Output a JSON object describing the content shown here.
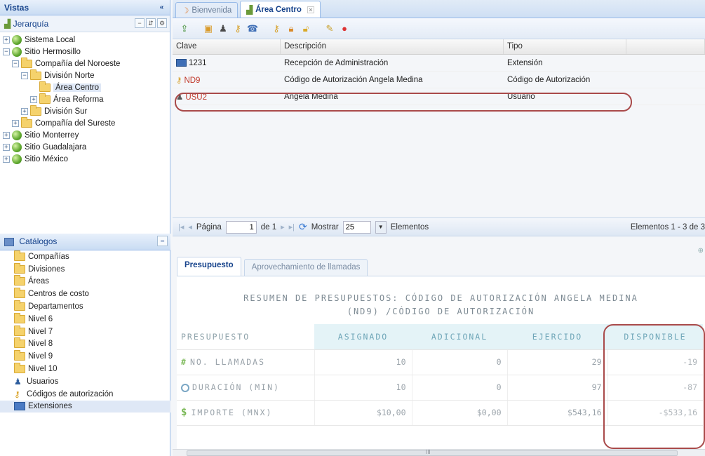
{
  "vistas": {
    "title": "Vistas",
    "collapse": "«"
  },
  "jerarquia": {
    "title": "Jerarquía",
    "tools": [
      "−",
      "⇵",
      "⚙"
    ]
  },
  "tree": [
    {
      "label": "Sistema Local",
      "level": 0,
      "icon": "globe",
      "exp": "+"
    },
    {
      "label": "Sitio Hermosillo",
      "level": 0,
      "icon": "globe",
      "exp": "−"
    },
    {
      "label": "Compañía del Noroeste",
      "level": 1,
      "icon": "folder",
      "exp": "−"
    },
    {
      "label": "División Norte",
      "level": 2,
      "icon": "folder",
      "exp": "−"
    },
    {
      "label": "Área Centro",
      "level": 3,
      "icon": "folder",
      "exp": "",
      "selected": true
    },
    {
      "label": "Área Reforma",
      "level": 3,
      "icon": "folder",
      "exp": "+"
    },
    {
      "label": "División Sur",
      "level": 2,
      "icon": "folder",
      "exp": "+"
    },
    {
      "label": "Compañía del Sureste",
      "level": 1,
      "icon": "folder",
      "exp": "+"
    },
    {
      "label": "Sitio Monterrey",
      "level": 0,
      "icon": "globe",
      "exp": "+"
    },
    {
      "label": "Sitio Guadalajara",
      "level": 0,
      "icon": "globe",
      "exp": "+"
    },
    {
      "label": "Sitio México",
      "level": 0,
      "icon": "globe",
      "exp": "+"
    }
  ],
  "catalogos": {
    "title": "Catálogos",
    "collapse": "−",
    "items": [
      {
        "label": "Compañías",
        "icon": "folder"
      },
      {
        "label": "Divisiones",
        "icon": "folder"
      },
      {
        "label": "Áreas",
        "icon": "folder"
      },
      {
        "label": "Centros de costo",
        "icon": "folder"
      },
      {
        "label": "Departamentos",
        "icon": "folder"
      },
      {
        "label": "Nivel 6",
        "icon": "folder"
      },
      {
        "label": "Nivel 7",
        "icon": "folder"
      },
      {
        "label": "Nivel 8",
        "icon": "folder"
      },
      {
        "label": "Nivel 9",
        "icon": "folder"
      },
      {
        "label": "Nivel 10",
        "icon": "folder"
      },
      {
        "label": "Usuarios",
        "icon": "user"
      },
      {
        "label": "Códigos de autorización",
        "icon": "key"
      },
      {
        "label": "Extensiones",
        "icon": "ext",
        "active": true
      }
    ]
  },
  "tabs": {
    "welcome": "Bienvenida",
    "area": "Área Centro"
  },
  "grid": {
    "headers": {
      "clave": "Clave",
      "descripcion": "Descripción",
      "tipo": "Tipo"
    },
    "rows": [
      {
        "clave": "1231",
        "descripcion": "Recepción de Administración",
        "tipo": "Extensión",
        "icon": "ext",
        "clave_color": "normal"
      },
      {
        "clave": "ND9",
        "descripcion": "Código de Autorización Angela Medina",
        "tipo": "Código de Autorización",
        "icon": "key",
        "clave_color": "red"
      },
      {
        "clave": "USU2",
        "descripcion": "Angela Medina",
        "tipo": "Usuario",
        "icon": "user",
        "clave_color": "red"
      }
    ]
  },
  "pager": {
    "pagina": "Página",
    "page": "1",
    "de": "de 1",
    "mostrar": "Mostrar",
    "size": "25",
    "elementos": "Elementos",
    "summary": "Elementos 1 - 3 de 3"
  },
  "lower_tabs": {
    "presupuesto": "Presupuesto",
    "aprovechamiento": "Aprovechamiento de llamadas"
  },
  "budget": {
    "title_line1": "RESUMEN DE PRESUPUESTOS: CÓDIGO DE AUTORIZACIÓN ANGELA MEDINA",
    "title_line2": "(ND9) /CÓDIGO DE AUTORIZACIÓN",
    "headers": [
      "PRESUPUESTO",
      "ASIGNADO",
      "ADICIONAL",
      "EJERCIDO",
      "DISPONIBLE"
    ],
    "rows": [
      {
        "name": "NO. LLAMADAS",
        "icon": "hash",
        "asignado": "10",
        "adicional": "0",
        "ejercido": "29",
        "disponible": "-19"
      },
      {
        "name": "DURACIÓN (MIN)",
        "icon": "clock",
        "asignado": "10",
        "adicional": "0",
        "ejercido": "97",
        "disponible": "-87"
      },
      {
        "name": "IMPORTE (MNX)",
        "icon": "dollar",
        "asignado": "$10,00",
        "adicional": "$0,00",
        "ejercido": "$543,16",
        "disponible": "-$533,16"
      }
    ]
  },
  "scrollbar_marker": "III",
  "colors": {
    "accent": "#15428b",
    "highlight_ring": "#a94a4a",
    "red_text": "#c0392b"
  }
}
